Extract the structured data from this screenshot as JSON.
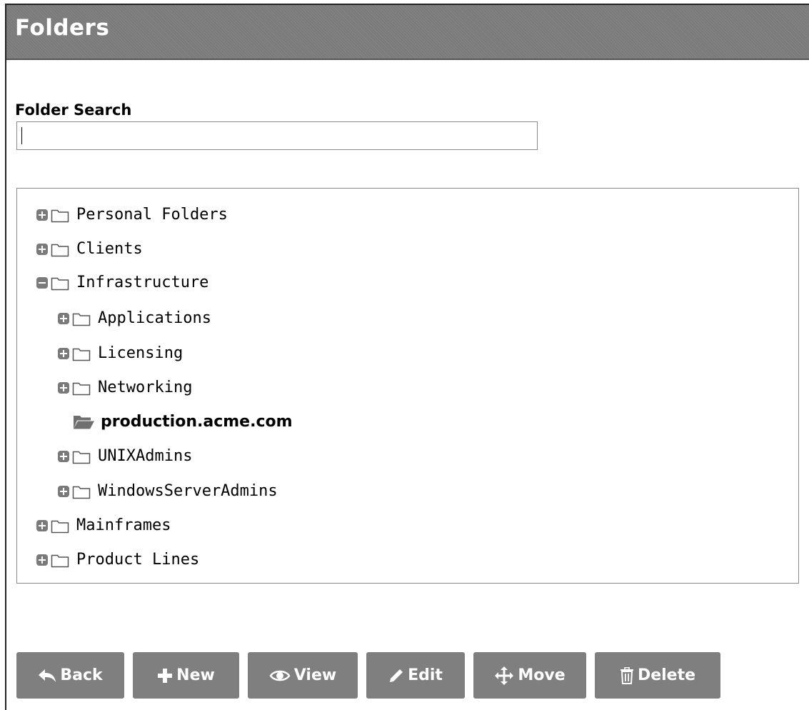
{
  "header": {
    "title": "Folders"
  },
  "search": {
    "label": "Folder Search",
    "value": "",
    "placeholder": ""
  },
  "tree": {
    "nodes": [
      {
        "label": "Personal Folders",
        "toggle": "plus"
      },
      {
        "label": "Clients",
        "toggle": "plus"
      },
      {
        "label": "Infrastructure",
        "toggle": "minus"
      },
      {
        "label": "Applications",
        "toggle": "plus"
      },
      {
        "label": "Licensing",
        "toggle": "plus"
      },
      {
        "label": "Networking",
        "toggle": "plus"
      },
      {
        "label": "production.acme.com",
        "toggle": "none",
        "selected": true,
        "icon": "folder-open-icon"
      },
      {
        "label": "UNIXAdmins",
        "toggle": "plus"
      },
      {
        "label": "WindowsServerAdmins",
        "toggle": "plus"
      },
      {
        "label": "Mainframes",
        "toggle": "plus"
      },
      {
        "label": "Product Lines",
        "toggle": "plus"
      }
    ]
  },
  "toolbar": {
    "back_label": "Back",
    "new_label": "New",
    "view_label": "View",
    "edit_label": "Edit",
    "move_label": "Move",
    "delete_label": "Delete"
  },
  "colors": {
    "header_bg": "#7b7b7b",
    "button_bg": "#7f7f7f",
    "toggle_bg": "#7a7a7a"
  }
}
